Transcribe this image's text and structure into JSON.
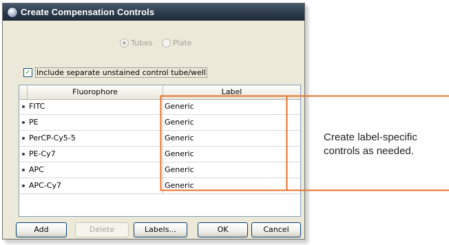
{
  "window": {
    "title": "Create Compensation Controls"
  },
  "format": {
    "options": [
      {
        "label": "Tubes",
        "selected": true
      },
      {
        "label": "Plate",
        "selected": false
      }
    ]
  },
  "unstained": {
    "label": "Include separate unstained control tube/well",
    "checked": true,
    "check_glyph": "✓"
  },
  "table": {
    "headers": {
      "fluorophore": "Fluorophore",
      "label": "Label"
    },
    "rows": [
      {
        "fluorophore": "FITC",
        "label": "Generic"
      },
      {
        "fluorophore": "PE",
        "label": "Generic"
      },
      {
        "fluorophore": "PerCP-Cy5-5",
        "label": "Generic"
      },
      {
        "fluorophore": "PE-Cy7",
        "label": "Generic"
      },
      {
        "fluorophore": "APC",
        "label": "Generic"
      },
      {
        "fluorophore": "APC-Cy7",
        "label": "Generic"
      }
    ]
  },
  "buttons": {
    "add": "Add",
    "delete": "Delete",
    "labels": "Labels...",
    "ok": "OK",
    "cancel": "Cancel"
  },
  "callout": {
    "line1": "Create label-specific",
    "line2": "controls as needed.",
    "color": "#e8702a"
  }
}
